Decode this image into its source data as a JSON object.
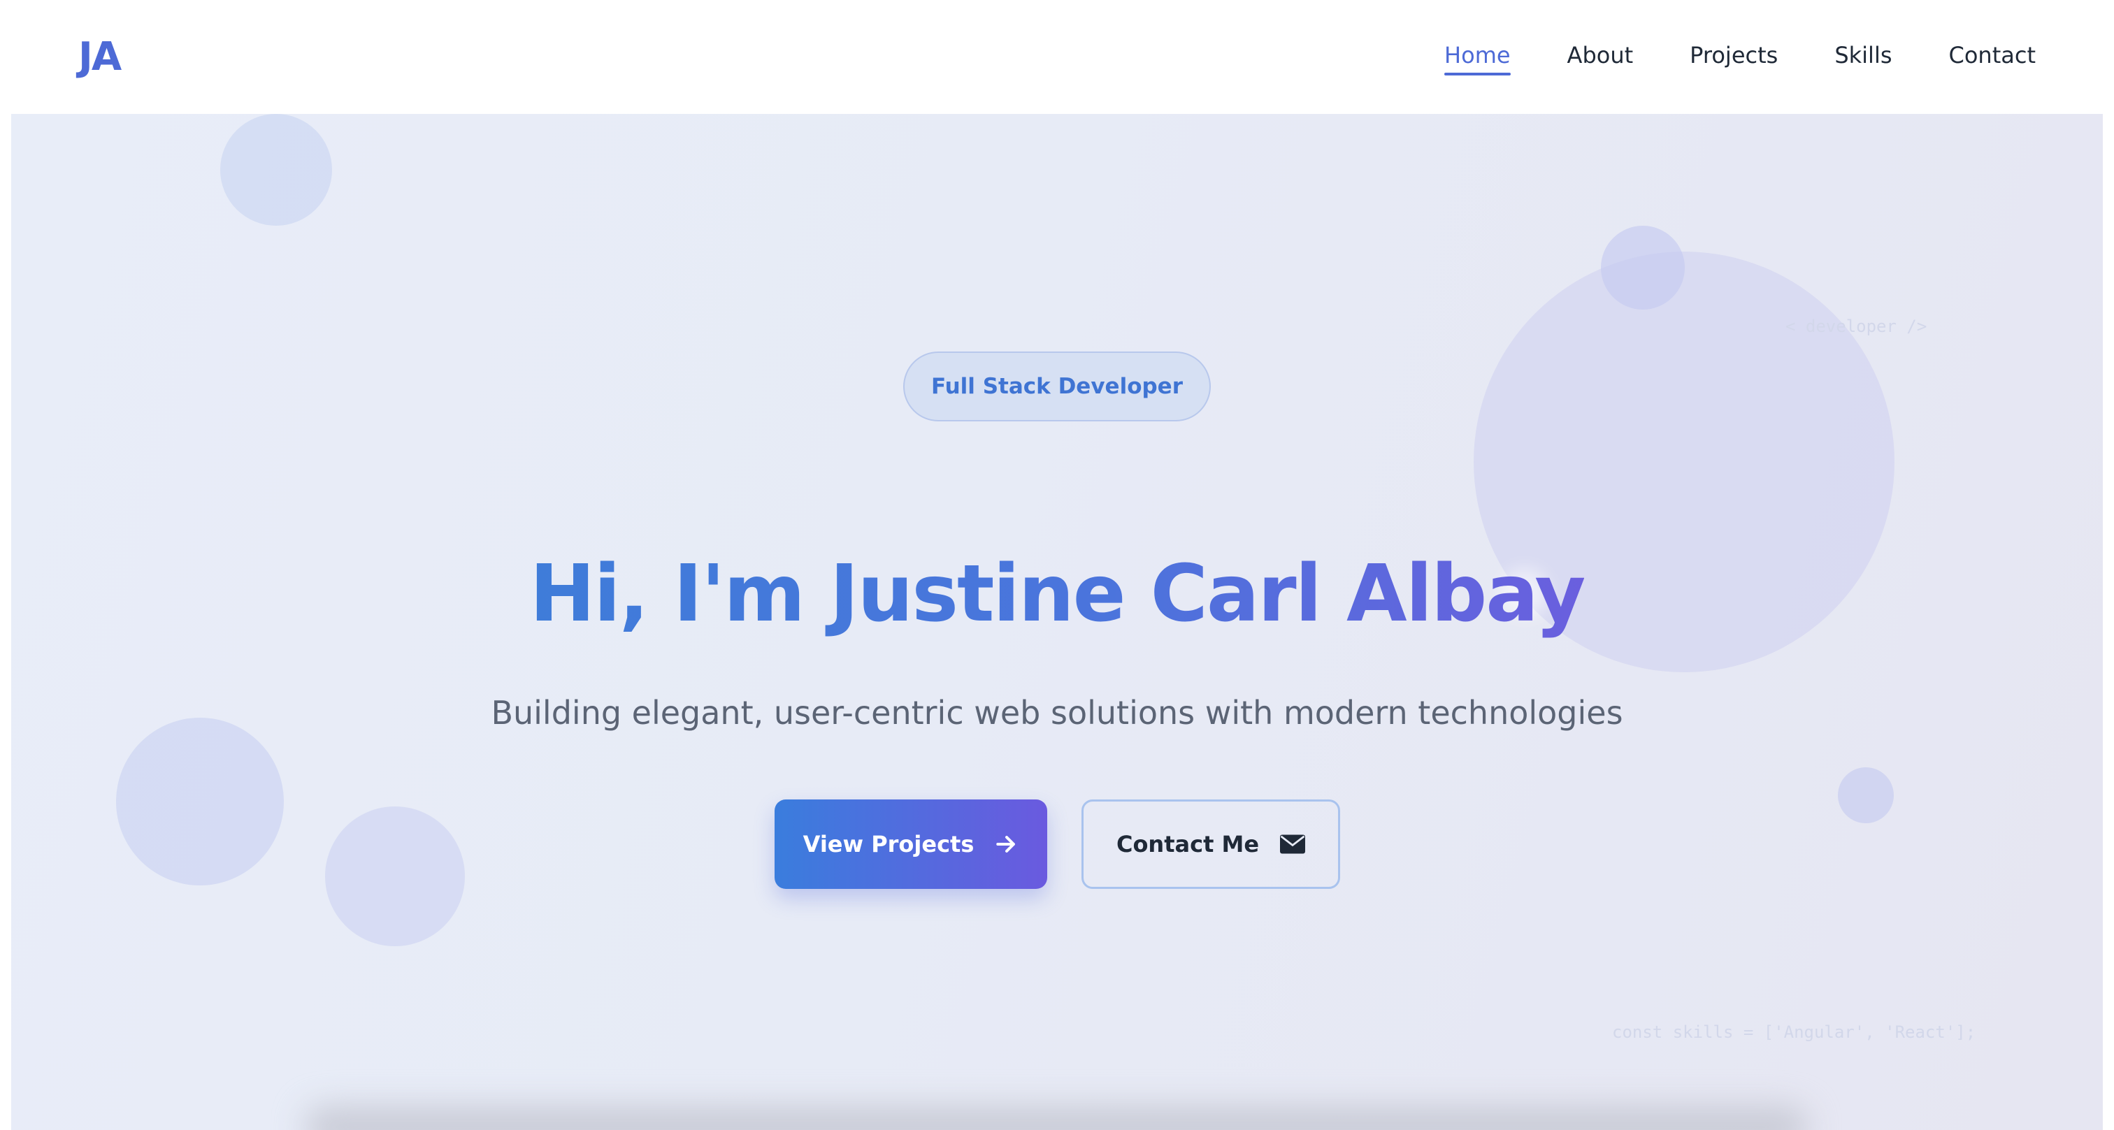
{
  "nav": {
    "logo": "JA",
    "links": [
      "Home",
      "About",
      "Projects",
      "Skills",
      "Contact"
    ],
    "active": "Home"
  },
  "hero": {
    "badge": "Full Stack Developer",
    "headline": "Hi, I'm Justine Carl Albay",
    "subtitle": "Building elegant, user-centric web solutions with modern technologies",
    "primary_button": {
      "label": "View Projects",
      "icon": "arrow-right-icon"
    },
    "secondary_button": {
      "label": "Contact Me",
      "icon": "envelope-icon"
    },
    "code_fragments": [
      "< developer />",
      "const skills = ['Angular', 'React'];"
    ]
  },
  "colors": {
    "accent": "#4d6ad6",
    "gradient_start": "#3a7ddd",
    "gradient_end": "#6a5adf",
    "text_dark": "#1f2937",
    "text_muted": "#5b6475"
  }
}
